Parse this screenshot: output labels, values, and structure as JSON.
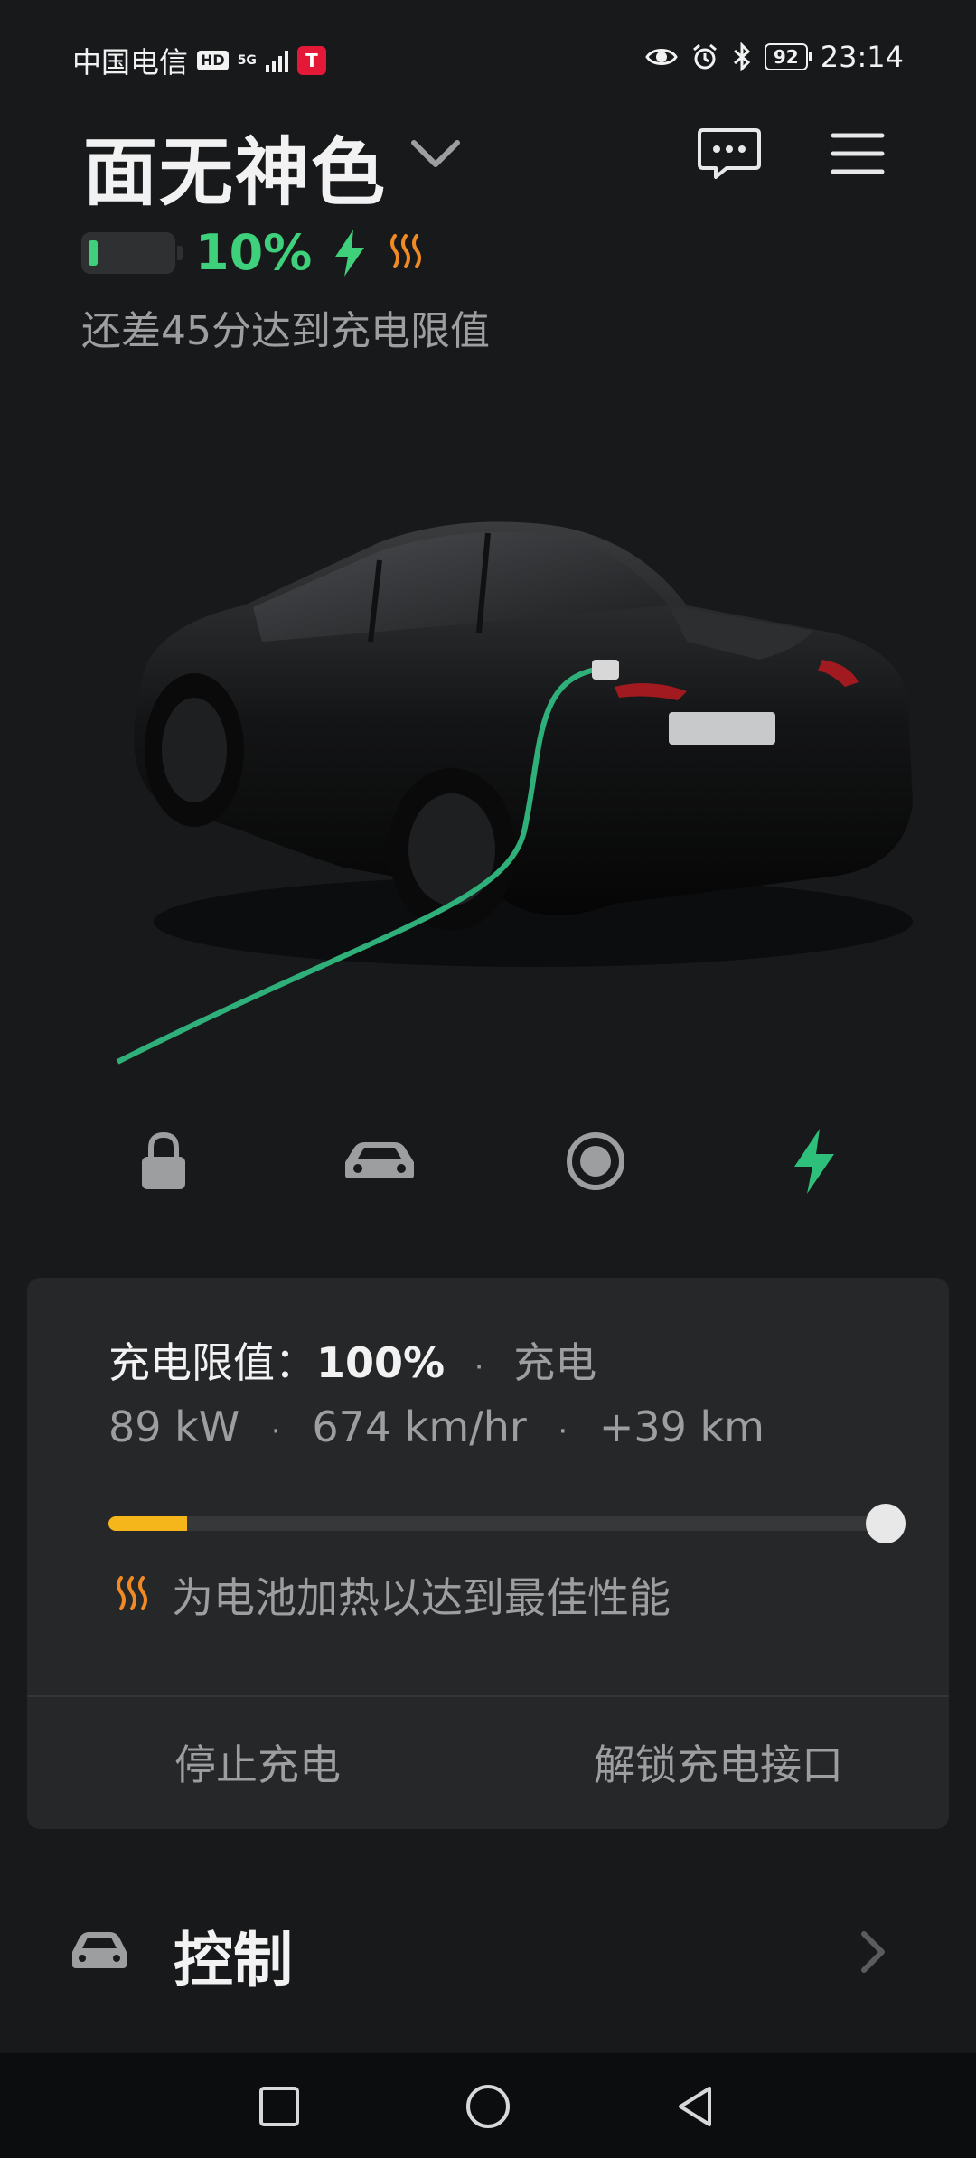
{
  "status_bar": {
    "carrier": "中国电信",
    "hd_badge": "HD",
    "network": "5G",
    "battery_level": "92",
    "time": "23:14",
    "icons": [
      "eye-icon",
      "alarm-icon",
      "bluetooth-icon"
    ]
  },
  "header": {
    "car_name": "面无神色",
    "battery_percent": "10%",
    "charge_time_text": "还差45分达到充电限值"
  },
  "quick_actions": [
    "lock-icon",
    "car-icon",
    "record-icon",
    "charge-bolt-icon"
  ],
  "charging_card": {
    "limit_label": "充电限值：",
    "limit_value": "100%",
    "sep": "·",
    "state": "充电",
    "power": "89 kW",
    "rate": "674 km/hr",
    "added": "+39 km",
    "current_level_fraction": 0.1,
    "limit_fraction": 1.0,
    "heat_text": "为电池加热以达到最佳性能",
    "stop_button": "停止充电",
    "unlock_button": "解锁充电接口"
  },
  "controls_row": {
    "label": "控制"
  },
  "colors": {
    "background": "#17191b",
    "card": "#262729",
    "green": "#3ed07a",
    "charge_green": "#2ec07a",
    "heat_orange": "#f08a24",
    "slider_yellow": "#f4b61a"
  }
}
